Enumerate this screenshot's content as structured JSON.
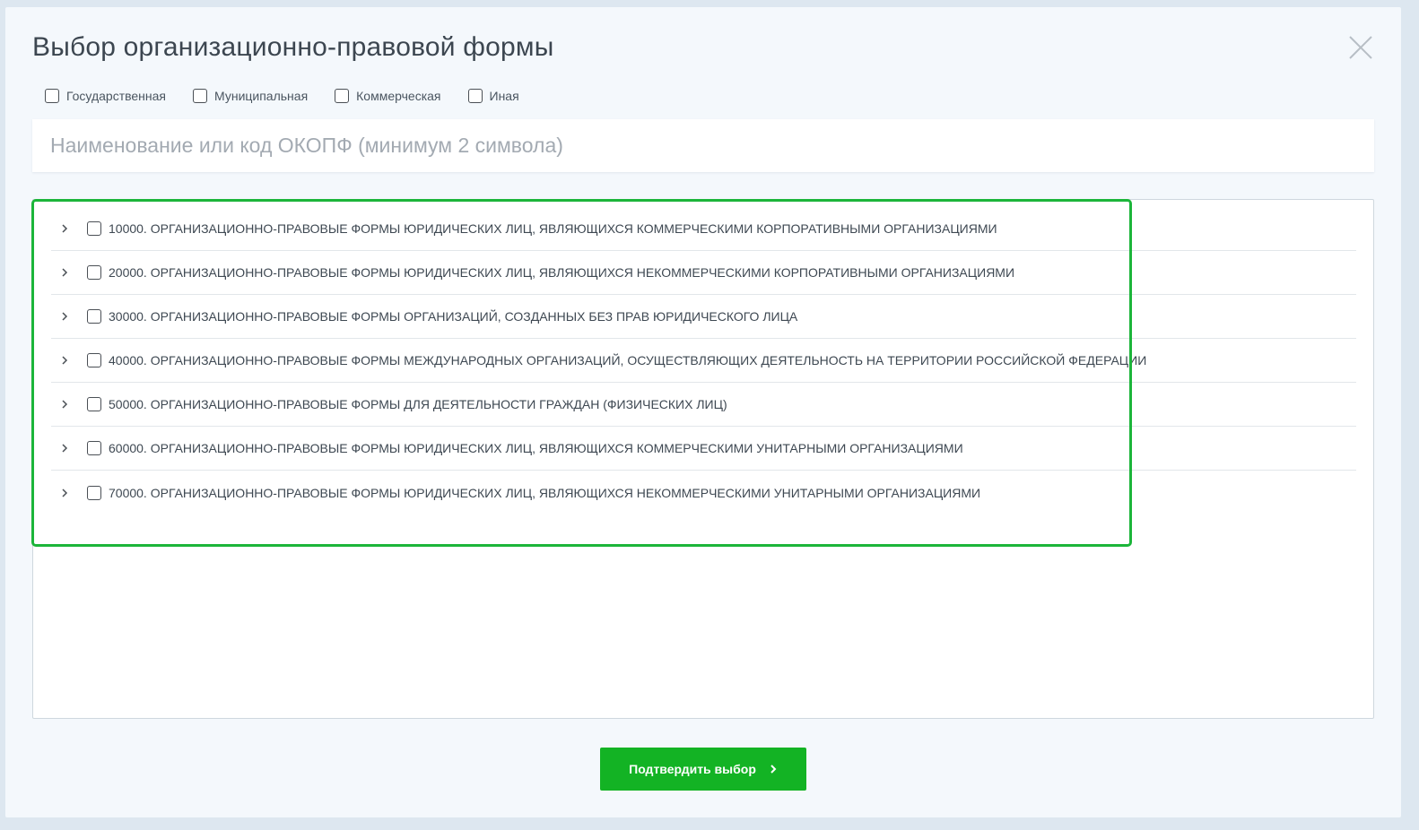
{
  "modal": {
    "title": "Выбор организационно-правовой формы",
    "close_icon": "close-icon"
  },
  "filters": [
    {
      "label": "Государственная",
      "checked": false
    },
    {
      "label": "Муниципальная",
      "checked": false
    },
    {
      "label": "Коммерческая",
      "checked": false
    },
    {
      "label": "Иная",
      "checked": false
    }
  ],
  "search": {
    "placeholder": "Наименование или код ОКОПФ (минимум 2 символа)",
    "value": ""
  },
  "tree": {
    "items": [
      {
        "label": "10000. ОРГАНИЗАЦИОННО-ПРАВОВЫЕ ФОРМЫ ЮРИДИЧЕСКИХ ЛИЦ, ЯВЛЯЮЩИХСЯ КОММЕРЧЕСКИМИ КОРПОРАТИВНЫМИ ОРГАНИЗАЦИЯМИ",
        "checked": false,
        "expanded": false
      },
      {
        "label": "20000. ОРГАНИЗАЦИОННО-ПРАВОВЫЕ ФОРМЫ ЮРИДИЧЕСКИХ ЛИЦ, ЯВЛЯЮЩИХСЯ НЕКОММЕРЧЕСКИМИ КОРПОРАТИВНЫМИ ОРГАНИЗАЦИЯМИ",
        "checked": false,
        "expanded": false
      },
      {
        "label": "30000. ОРГАНИЗАЦИОННО-ПРАВОВЫЕ ФОРМЫ ОРГАНИЗАЦИЙ, СОЗДАННЫХ БЕЗ ПРАВ ЮРИДИЧЕСКОГО ЛИЦА",
        "checked": false,
        "expanded": false
      },
      {
        "label": "40000. ОРГАНИЗАЦИОННО-ПРАВОВЫЕ ФОРМЫ МЕЖДУНАРОДНЫХ ОРГАНИЗАЦИЙ, ОСУЩЕСТВЛЯЮЩИХ ДЕЯТЕЛЬНОСТЬ НА ТЕРРИТОРИИ РОССИЙСКОЙ ФЕДЕРАЦИИ",
        "checked": false,
        "expanded": false
      },
      {
        "label": "50000. ОРГАНИЗАЦИОННО-ПРАВОВЫЕ ФОРМЫ ДЛЯ ДЕЯТЕЛЬНОСТИ ГРАЖДАН (ФИЗИЧЕСКИХ ЛИЦ)",
        "checked": false,
        "expanded": false
      },
      {
        "label": "60000. ОРГАНИЗАЦИОННО-ПРАВОВЫЕ ФОРМЫ ЮРИДИЧЕСКИХ ЛИЦ, ЯВЛЯЮЩИХСЯ КОММЕРЧЕСКИМИ УНИТАРНЫМИ ОРГАНИЗАЦИЯМИ",
        "checked": false,
        "expanded": false
      },
      {
        "label": "70000. ОРГАНИЗАЦИОННО-ПРАВОВЫЕ ФОРМЫ ЮРИДИЧЕСКИХ ЛИЦ, ЯВЛЯЮЩИХСЯ НЕКОММЕРЧЕСКИМИ УНИТАРНЫМИ ОРГАНИЗАЦИЯМИ",
        "checked": false,
        "expanded": false
      }
    ],
    "expander_icon": "chevron-right-icon",
    "highlight_color": "#1cb53a"
  },
  "confirm": {
    "label": "Подтвердить выбор",
    "icon": "chevron-right-icon",
    "color": "#13b324"
  }
}
